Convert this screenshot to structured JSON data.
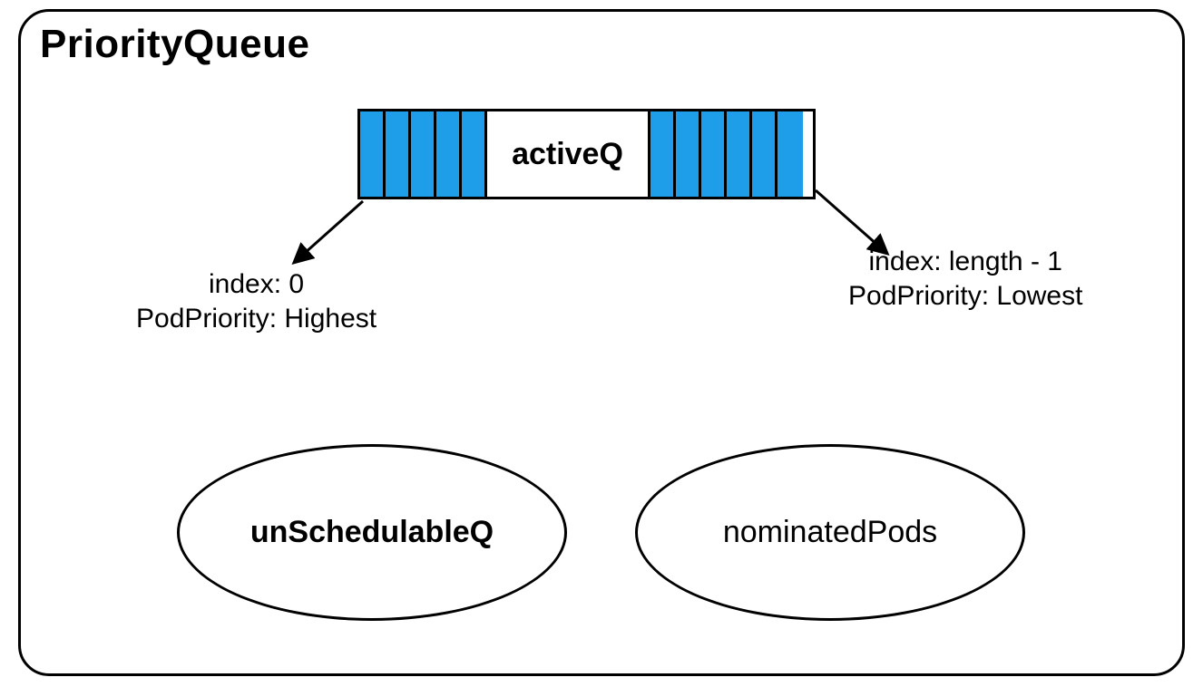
{
  "title": "PriorityQueue",
  "activeQ": {
    "label": "activeQ",
    "left_cells": 5,
    "right_cells": 6,
    "cell_color": "#1e9ee8"
  },
  "annotations": {
    "left": {
      "line1": "index: 0",
      "line2": "PodPriority: Highest"
    },
    "right": {
      "line1": "index: length - 1",
      "line2": "PodPriority: Lowest"
    }
  },
  "bubbles": {
    "unschedulable": "unSchedulableQ",
    "nominated": "nominatedPods"
  },
  "chart_data": {
    "type": "diagram",
    "container": "PriorityQueue",
    "components": [
      {
        "name": "activeQ",
        "kind": "ordered-array",
        "head": {
          "index": "0",
          "podPriority": "Highest"
        },
        "tail": {
          "index": "length - 1",
          "podPriority": "Lowest"
        },
        "segments": {
          "left_filled": 5,
          "right_filled": 6
        }
      },
      {
        "name": "unSchedulableQ",
        "kind": "set"
      },
      {
        "name": "nominatedPods",
        "kind": "set"
      }
    ]
  }
}
